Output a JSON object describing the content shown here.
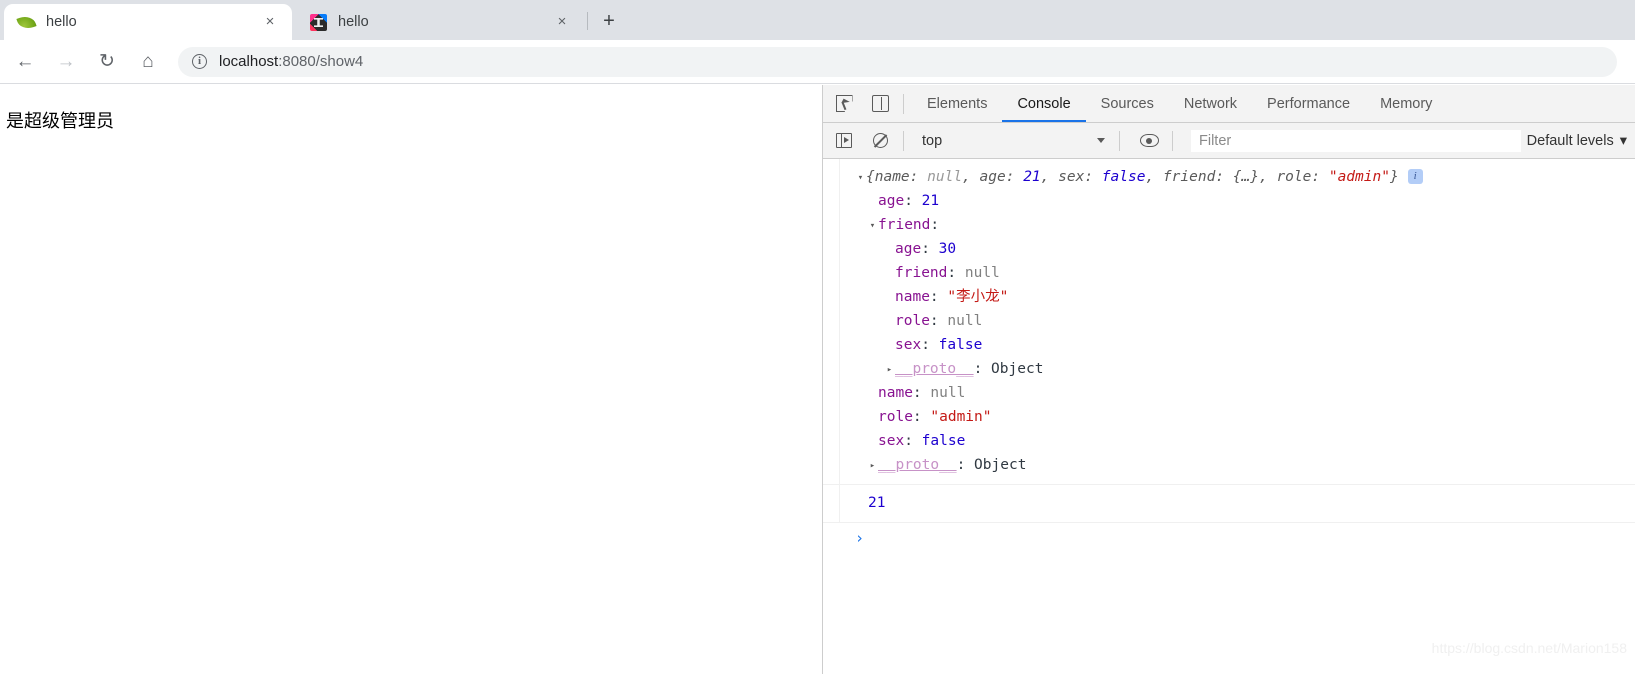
{
  "browser": {
    "tabs": [
      {
        "title": "hello",
        "favicon": "spring-leaf-icon",
        "active": true,
        "close_label": "×"
      },
      {
        "title": "hello",
        "favicon": "intellij-idea-icon",
        "active": false,
        "close_label": "×"
      }
    ],
    "new_tab_label": "+",
    "nav": {
      "back_label": "←",
      "forward_label": "→",
      "reload_label": "↻",
      "home_label": "⌂"
    },
    "omnibox": {
      "info_label": "i",
      "url_host": "localhost",
      "url_rest": ":8080/show4"
    }
  },
  "page": {
    "text": "是超级管理员"
  },
  "devtools": {
    "tabs": [
      {
        "label": "Elements",
        "active": false
      },
      {
        "label": "Console",
        "active": true
      },
      {
        "label": "Sources",
        "active": false
      },
      {
        "label": "Network",
        "active": false
      },
      {
        "label": "Performance",
        "active": false
      },
      {
        "label": "Memory",
        "active": false
      }
    ],
    "filterbar": {
      "context": "top",
      "filter_placeholder": "Filter",
      "filter_value": "",
      "levels_label": "Default levels",
      "levels_caret": "▾"
    },
    "console": {
      "messages": [
        {
          "type": "object-preview",
          "triangle": "▾",
          "preview_open": "{",
          "preview_items": [
            {
              "key": "name",
              "value": "null",
              "kind": "null"
            },
            {
              "key": "age",
              "value": "21",
              "kind": "num"
            },
            {
              "key": "sex",
              "value": "false",
              "kind": "bool"
            },
            {
              "key": "friend",
              "value": "{…}",
              "kind": "plain"
            },
            {
              "key": "role",
              "value": "\"admin\"",
              "kind": "str"
            }
          ],
          "preview_close": "}",
          "info_badge": "i",
          "children": [
            {
              "indent": 1,
              "key": "age",
              "value": "21",
              "kind": "num"
            },
            {
              "indent": 1,
              "key": "friend",
              "value": "",
              "kind": "plain",
              "triangle": "▾"
            },
            {
              "indent": 2,
              "key": "age",
              "value": "30",
              "kind": "num"
            },
            {
              "indent": 2,
              "key": "friend",
              "value": "null",
              "kind": "null"
            },
            {
              "indent": 2,
              "key": "name",
              "value": "\"李小龙\"",
              "kind": "str"
            },
            {
              "indent": 2,
              "key": "role",
              "value": "null",
              "kind": "null"
            },
            {
              "indent": 2,
              "key": "sex",
              "value": "false",
              "kind": "bool"
            },
            {
              "indent": 2,
              "key": "__proto__",
              "value": "Object",
              "kind": "proto",
              "triangle": "▸"
            },
            {
              "indent": 1,
              "key": "name",
              "value": "null",
              "kind": "null"
            },
            {
              "indent": 1,
              "key": "role",
              "value": "\"admin\"",
              "kind": "str"
            },
            {
              "indent": 1,
              "key": "sex",
              "value": "false",
              "kind": "bool"
            },
            {
              "indent": 1,
              "key": "__proto__",
              "value": "Object",
              "kind": "proto",
              "triangle": "▸"
            }
          ]
        },
        {
          "type": "result",
          "value": "21"
        }
      ],
      "prompt": "›"
    },
    "icons": {
      "inspect": "inspect-element-icon",
      "device": "device-toolbar-icon",
      "sidebar": "console-sidebar-icon",
      "clear": "clear-console-icon",
      "eye": "live-expression-icon"
    }
  },
  "watermark": "https://blog.csdn.net/Marion158",
  "colors": {
    "accent": "#1a73e8",
    "tabstrip": "#dee1e6",
    "string": "#c41a16",
    "number": "#1c00cf",
    "property": "#881391"
  }
}
